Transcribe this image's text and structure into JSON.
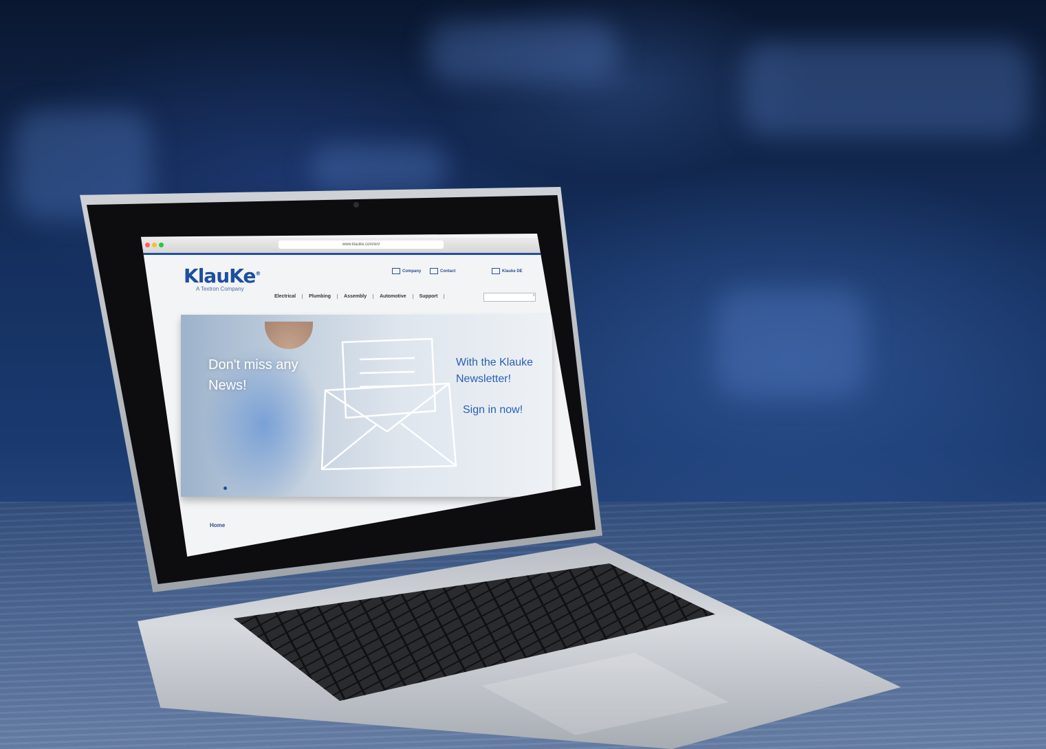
{
  "browser": {
    "url": "www.klauke.com/en/"
  },
  "site": {
    "logo_text": "KlauKe",
    "tagline": "A Textron Company",
    "utility_links": [
      "Company",
      "Contact",
      "Klauke DE"
    ],
    "nav": [
      "Electrical",
      "Plumbing",
      "Assembly",
      "Automotive",
      "Support"
    ]
  },
  "hero": {
    "left_text": "Don't miss any News!",
    "right_text": "With the Klauke Newsletter!",
    "cta_text": "Sign in now!"
  },
  "breadcrumb": {
    "home": "Home"
  },
  "colors": {
    "brand_blue": "#1d4f9f",
    "hero_text_blue": "#2a5fb2"
  }
}
